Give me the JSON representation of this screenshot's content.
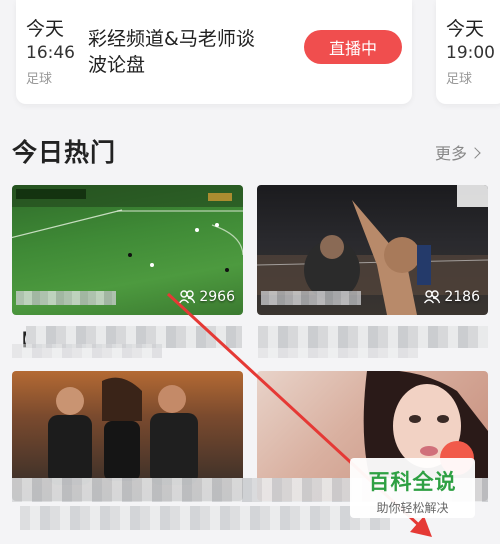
{
  "schedule": [
    {
      "day": "今天",
      "time": "16:46",
      "sport": "足球",
      "title": "彩经频道&马老师谈波论盘",
      "button": "直播中"
    },
    {
      "day": "今天",
      "time": "19:00",
      "sport": "足球"
    }
  ],
  "hot": {
    "title": "今日热门",
    "more": "更多",
    "tiles": [
      {
        "viewers": "2966",
        "icon": "people-icon"
      },
      {
        "viewers": "2186",
        "icon": "people-icon"
      },
      {
        "icon": "none"
      },
      {
        "icon": "none"
      }
    ],
    "caption_prefix": "【"
  },
  "watermark": {
    "title": "百科全说",
    "subtitle": "助你轻松解决"
  },
  "colors": {
    "live": "#f04e4e",
    "watermark_green": "#2ea043",
    "arrow": "#e53935"
  }
}
